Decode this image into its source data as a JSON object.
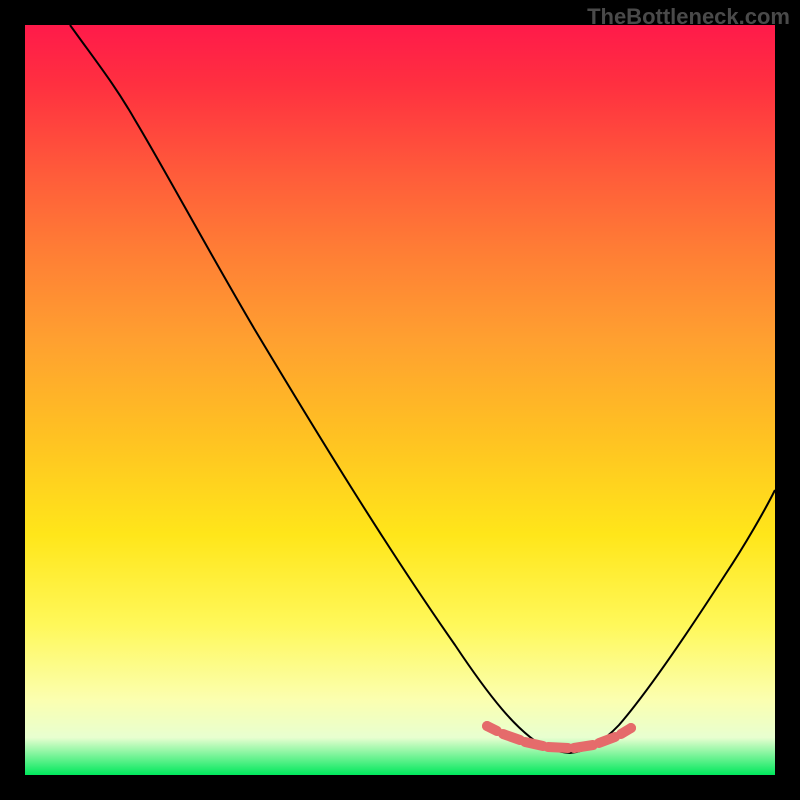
{
  "watermark": "TheBottleneck.com",
  "chart_data": {
    "type": "line",
    "title": "",
    "xlabel": "",
    "ylabel": "",
    "xlim": [
      0,
      100
    ],
    "ylim": [
      0,
      100
    ],
    "grid": false,
    "legend": false,
    "series": [
      {
        "name": "bottleneck-curve",
        "color": "#000000",
        "x": [
          6,
          12,
          20,
          30,
          40,
          50,
          60,
          64,
          68,
          72,
          74,
          76,
          80,
          84,
          90,
          100
        ],
        "y": [
          100,
          94,
          83,
          68,
          53,
          38,
          23,
          14,
          8,
          4,
          3,
          4,
          8,
          17,
          33,
          62
        ]
      },
      {
        "name": "optimal-region",
        "color": "#e56b6b",
        "x": [
          62,
          64,
          66,
          68,
          70,
          72,
          74,
          76,
          78,
          80,
          82
        ],
        "y": [
          9.5,
          8.1,
          7.1,
          6.3,
          5.7,
          5.3,
          5.2,
          5.3,
          5.8,
          6.7,
          8.2
        ]
      }
    ],
    "background_gradient": {
      "top_color": "#ff1a4a",
      "bottom_color": "#00e85c",
      "meaning": "bottleneck-severity"
    },
    "optimal_x_range": [
      62,
      82
    ]
  }
}
